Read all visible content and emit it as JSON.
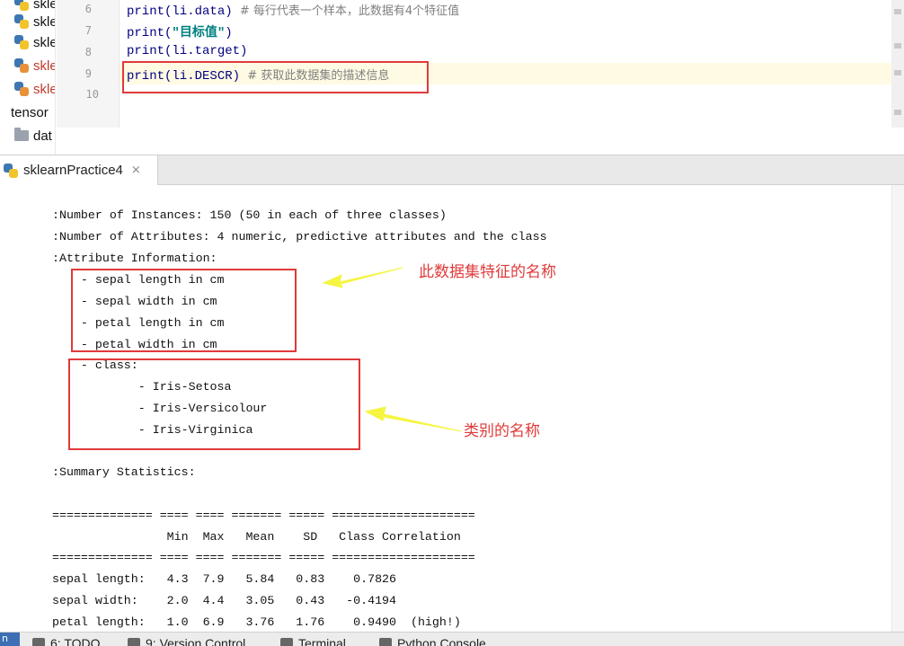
{
  "project_tree": {
    "items": [
      {
        "label": "skle",
        "icon": "python-file-icon"
      },
      {
        "label": "skle",
        "icon": "python-file-icon"
      },
      {
        "label": "skle",
        "icon": "python-file-icon"
      },
      {
        "label": "skle",
        "icon": "python-file-icon"
      },
      {
        "label": "tensor",
        "icon": "none"
      },
      {
        "label": "dat",
        "icon": "folder-icon"
      }
    ]
  },
  "editor": {
    "line_numbers": [
      "6",
      "7",
      "8",
      "9",
      "10"
    ],
    "lines": [
      {
        "code": "print(li.data)",
        "comment": "  # 每行代表一个样本，此数据有4个特征值"
      },
      {
        "pre": "print(",
        "string": "\"目标值\"",
        "post": ")"
      },
      {
        "code": "print(li.target)"
      },
      {
        "code": "print(li.DESCR)",
        "comment": "  # 获取此数据集的描述信息"
      },
      {
        "code": ""
      }
    ]
  },
  "run_tab": {
    "label": "sklearnPractice4",
    "close": "×"
  },
  "console": {
    "lines": [
      ":Number of Instances: 150 (50 in each of three classes)",
      ":Number of Attributes: 4 numeric, predictive attributes and the class",
      ":Attribute Information:",
      "    - sepal length in cm",
      "    - sepal width in cm",
      "    - petal length in cm",
      "    - petal width in cm",
      "    - class:",
      "            - Iris-Setosa",
      "            - Iris-Versicolour",
      "            - Iris-Virginica",
      ":Summary Statistics:",
      "============== ==== ==== ======= ===== ====================",
      "                Min  Max   Mean    SD   Class Correlation",
      "============== ==== ==== ======= ===== ====================",
      "sepal length:   4.3  7.9   5.84   0.83    0.7826",
      "sepal width:    2.0  4.4   3.05   0.43   -0.4194",
      "petal length:   1.0  6.9   3.76   1.76    0.9490  (high!)"
    ]
  },
  "annotations": {
    "features_label": "此数据集特征的名称",
    "classes_label": "类别的名称",
    "color": "#e03a3a",
    "arrow_color": "#f5f542"
  },
  "bottom_bar": {
    "corner": "n",
    "tools": [
      {
        "label": "6: TODO",
        "icon": "todo-icon"
      },
      {
        "label": "9: Version Control",
        "icon": "version-control-icon"
      },
      {
        "label": "Terminal",
        "icon": "terminal-icon"
      },
      {
        "label": "Python Console",
        "icon": "python-console-icon"
      }
    ]
  }
}
